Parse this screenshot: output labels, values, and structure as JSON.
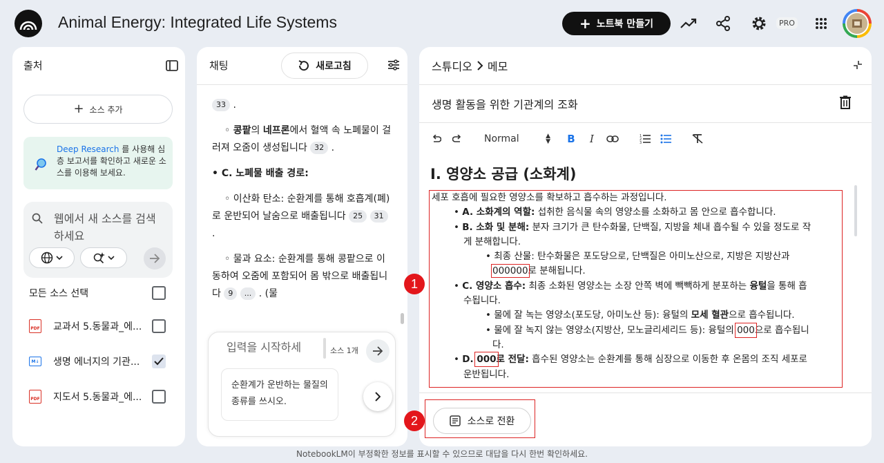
{
  "header": {
    "app_title": "Animal Energy: Integrated Life Systems",
    "new_notebook_label": "노트북 만들기",
    "pro_badge": "PRO"
  },
  "sources": {
    "title": "출처",
    "add_source_label": "소스 추가",
    "deep_research_link": "Deep Research",
    "deep_research_text": " 를 사용해 심층 보고서를 확인하고 새로운 소스를 이용해 보세요.",
    "web_search_placeholder": "웹에서 새 소스를 검색하세요",
    "select_all_label": "모든 소스 선택",
    "items": [
      {
        "label": "교과서 5.동물과_에...",
        "type": "PDF",
        "checked": false
      },
      {
        "label": "생명 에너지의 기관...",
        "type": "MD",
        "checked": true
      },
      {
        "label": "지도서 5.동물과_에...",
        "type": "PDF",
        "checked": false
      }
    ]
  },
  "chat": {
    "title": "채팅",
    "refresh_label": "새로고침",
    "cite_33": "33",
    "line1_pre": "◦ ",
    "line1_bold1": "콩팥",
    "line1_mid": "의 ",
    "line1_bold2": "네프론",
    "line1_rest": "에서 혈액 속 노폐물이 걸러져 오줌이 생성됩니다",
    "cite_32": "32",
    "heading_c": "• C. 노폐물 배출 경로:",
    "co2_text": "◦ 이산화 탄소: 순환계를 통해 호흡계(폐)로 운반되어 날숨으로 배출됩니다",
    "cite_25": "25",
    "cite_31": "31",
    "water_text": "◦ 물과 요소: 순환계를 통해 콩팥으로 이동하여 오줌에 포함되어 몸 밖으로 배출됩니다",
    "cite_9": "9",
    "cite_more": "...",
    "water_tail": ". (물",
    "input_placeholder": "입력을 시작하세요",
    "source_count": "소스 1개",
    "suggestion": "순환계가 운반하는 물질의 종류를 쓰시오."
  },
  "studio": {
    "crumb_studio": "스튜디오",
    "crumb_note": "메모",
    "note_title": "생명 활동을 위한 기관계의 조화",
    "style_select": "Normal",
    "heading": "I. 영양소 공급 (소화계)",
    "intro": "세포 호흡에 필요한 영양소를 확보하고 흡수하는 과정입니다.",
    "a_label": "A. 소화계의 역할:",
    "a_text": " 섭취한 음식물 속의 영양소를 소화하고 몸 안으로 흡수합니다.",
    "b_label": "B. 소화 및 분해:",
    "b_text1": " 분자 크기가 큰 탄수화물, 단백질, 지방을 체내 흡수될 수 있을 정도로 작",
    "b_text2": "게 분해합니다.",
    "b_sub1": "최종 산물: 탄수화물은 포도당으로, 단백질은 아미노산으로, 지방은 지방산과",
    "b_sub2_blank": "000000",
    "b_sub2_rest": "로 분해됩니다.",
    "c_label": "C. 영양소 흡수:",
    "c_text1": " 최종 소화된 영양소는 소장 안쪽 벽에 빽빽하게 분포하는 ",
    "c_bold": "융털",
    "c_text1b": "을 통해 흡",
    "c_text2": "수됩니다.",
    "c_sub1_pre": "물에 잘 녹는 영양소(포도당, 아미노산 등): 융털의 ",
    "c_sub1_bold": "모세 혈관",
    "c_sub1_post": "으로 흡수됩니다.",
    "c_sub2_pre": "물에 잘 녹지 않는 영양소(지방산, 모노글리세리드 등): 융털의 ",
    "c_sub2_blank": "000",
    "c_sub2_post": "으로 흡수됩니",
    "c_sub2_tail": "다.",
    "d_pre": "D. ",
    "d_blank": "000",
    "d_label_rest": "로 전달:",
    "d_text": " 흡수된 영양소는 순환계를 통해 심장으로 이동한 후 온몸의 조직 세포로",
    "d_text2": "운반됩니다.",
    "convert_label": "소스로 전환",
    "marker1": "1",
    "marker2": "2"
  },
  "footer": "NotebookLM이 부정확한 정보를 표시할 수 있으므로 대답을 다시 한번 확인하세요.",
  "colors": {
    "accent": "#1a73e8",
    "annotation_red": "#e3161b",
    "dark": "#111111"
  }
}
